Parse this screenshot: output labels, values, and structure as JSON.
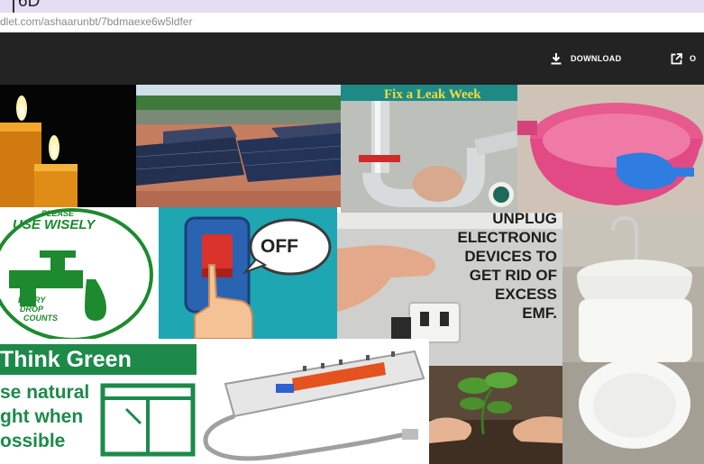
{
  "header": {
    "title_fragment": "6D",
    "url": "dlet.com/ashaarunbt/7bdmaexe6w5ldfer"
  },
  "toolbar": {
    "download_label": "DOWNLOAD",
    "open_label": "O"
  },
  "icons": {
    "download": "download-icon",
    "open": "external-link-icon"
  },
  "collage": {
    "leak_banner": "Fix a Leak Week",
    "tap_sign": {
      "top_line1": "PLEASE",
      "top_line2": "USE WISELY",
      "bottom_line1": "EVERY",
      "bottom_line2": "DROP",
      "bottom_line3": "COUNTS"
    },
    "off_label": "OFF",
    "unplug_lines": [
      "UNPLUG",
      "ELECTRONIC",
      "DEVICES TO",
      "GET RID OF",
      "EXCESS",
      "EMF."
    ],
    "think_green": {
      "heading": "Think Green",
      "lines": [
        "se natural",
        "ght when",
        "ossible"
      ]
    }
  },
  "colors": {
    "top_strip": "#e4dcf3",
    "toolbar_bg": "#232323",
    "think_green": "#1d8a4a",
    "leak_banner": "#f3dc3e",
    "off_tile": "#1fa6b3"
  }
}
